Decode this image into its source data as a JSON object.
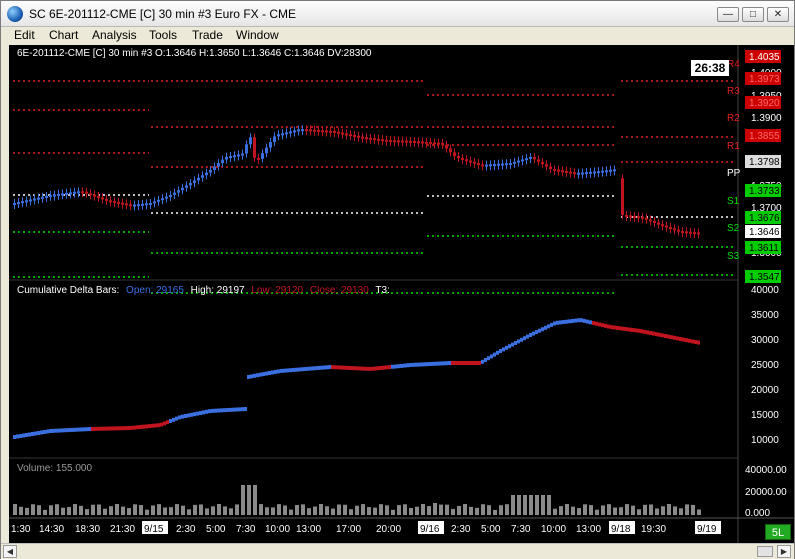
{
  "window": {
    "title": "SC 6E-201112-CME [C]  30 min  #3  Euro FX - CME",
    "minimize_glyph": "—",
    "maximize_glyph": "□",
    "close_glyph": "✕"
  },
  "menu": [
    "Edit",
    "Chart",
    "Analysis",
    "Tools",
    "Trade",
    "Window"
  ],
  "chart_header": "6E-201112-CME [C]  30 min   #3 O:1.3646 H:1.3650 L:1.3646 C:1.3646 DV:28300",
  "timer": "26:38",
  "price_panel": {
    "axis_labels": [
      "1.4000",
      "1.3950",
      "1.3900",
      "1.3800",
      "1.3750",
      "1.3700",
      "1.3600"
    ],
    "price_boxes": [
      {
        "text": "1.4035",
        "bg": "#cc0000",
        "fg": "#ffffff"
      },
      {
        "text": "1.3973",
        "bg": "#cc0000",
        "fg": "#ff6666"
      },
      {
        "text": "1.3920",
        "bg": "#cc0000",
        "fg": "#ff6666"
      },
      {
        "text": "1.3855",
        "bg": "#cc0000",
        "fg": "#ff6666"
      },
      {
        "text": "1.3798",
        "bg": "#dddddd",
        "fg": "#000000"
      },
      {
        "text": "1.3733",
        "bg": "#00cc00",
        "fg": "#000000"
      },
      {
        "text": "1.3676",
        "bg": "#00cc00",
        "fg": "#000000"
      },
      {
        "text": "1.3646",
        "bg": "#ffffff",
        "fg": "#000000"
      },
      {
        "text": "1.3611",
        "bg": "#00cc00",
        "fg": "#000000"
      },
      {
        "text": "1.3547",
        "bg": "#00cc00",
        "fg": "#000000"
      }
    ],
    "pivot_labels": [
      "R4",
      "R3",
      "R2",
      "R1",
      "PP",
      "S1",
      "S2",
      "S3"
    ],
    "colors": {
      "bull": "#3b6fe0",
      "bear": "#c0141e",
      "resistance": "#e02020",
      "pivot": "#ffffff",
      "support": "#00dd00"
    }
  },
  "delta_panel": {
    "title": "Cumulative Delta Bars:",
    "open": "Open: 29165",
    "high": "High: 29197",
    "low": "Low: 29120",
    "close": "Close: 29130",
    "t3": "T3:",
    "axis_labels": [
      "40000",
      "35000",
      "30000",
      "25000",
      "20000",
      "15000",
      "10000"
    ]
  },
  "volume_panel": {
    "title": "Volume: 155.000",
    "axis_labels": [
      "40000.00",
      "20000.00",
      "0.000"
    ]
  },
  "time_axis": [
    "1:30",
    "14:30",
    "18:30",
    "21:30",
    "9/15",
    "2:30",
    "5:00",
    "7:30",
    "10:00",
    "13:00",
    "17:00",
    "20:00",
    "9/16",
    "2:30",
    "5:00",
    "7:30",
    "10:00",
    "13:00",
    "9/18",
    "19:30",
    "9/19"
  ],
  "scale_button": "5L",
  "scroll": {
    "left_glyph": "◀",
    "right_glyph": "▶"
  }
}
